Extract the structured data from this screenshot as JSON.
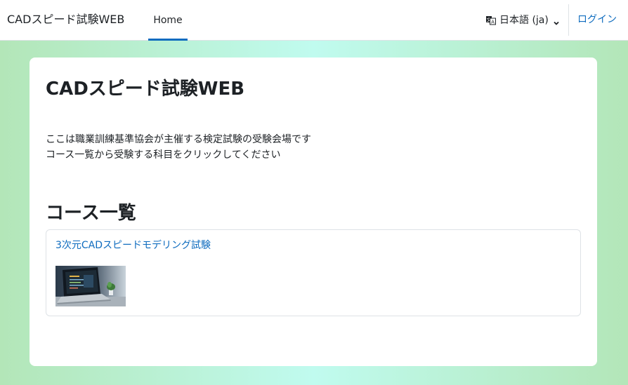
{
  "navbar": {
    "brand": "CADスピード試験WEB",
    "home_tab": "Home",
    "language": "日本語 (ja)",
    "language_icon": "language-icon",
    "login": "ログイン"
  },
  "main": {
    "title": "CADスピード試験WEB",
    "intro_line1": "ここは職業訓練基準協会が主催する検定試験の受験会場です",
    "intro_line2": "コース一覧から受験する科目をクリックしてください",
    "section_title": "コース一覧",
    "courses": [
      {
        "name": "3次元CADスピードモデリング試験",
        "image": "laptop-on-desk-thumbnail"
      }
    ]
  },
  "colors": {
    "link": "#0f6cbf",
    "active_tab_underline": "#0f6cbf",
    "background_edge": "#b3e6b8",
    "background_center": "#c0fbef"
  }
}
